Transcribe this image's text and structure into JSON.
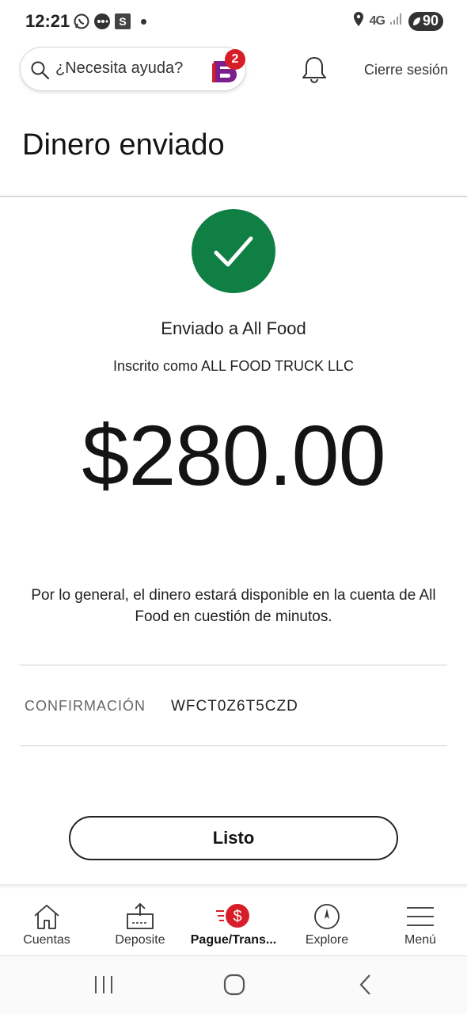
{
  "status_bar": {
    "time": "12:21",
    "network": "4G",
    "battery": "90"
  },
  "header": {
    "search_label": "¿Necesita ayuda?",
    "assistant_badge_count": "2",
    "logout_label": "Cierre sesión"
  },
  "page": {
    "title": "Dinero enviado"
  },
  "confirmation_screen": {
    "sent_to": "Enviado a All Food",
    "enrolled_as": "Inscrito como ALL FOOD TRUCK LLC",
    "amount": "$280.00",
    "note": "Por lo general, el dinero estará disponible en la cuenta de All Food en cuestión de minutos.",
    "confirmation_label": "CONFIRMACIÓN",
    "confirmation_code": "WFCT0Z6T5CZD",
    "done_button": "Listo"
  },
  "bottom_nav": {
    "items": [
      {
        "label": "Cuentas",
        "icon": "home-icon"
      },
      {
        "label": "Deposite",
        "icon": "deposit-icon"
      },
      {
        "label": "Pague/Trans...",
        "icon": "pay-transfer-icon",
        "active": true
      },
      {
        "label": "Explore",
        "icon": "compass-icon"
      },
      {
        "label": "Menú",
        "icon": "menu-icon"
      }
    ]
  },
  "colors": {
    "success": "#0f7f44",
    "brand_red": "#d71e28",
    "brand_purple": "#7b1f8c"
  }
}
